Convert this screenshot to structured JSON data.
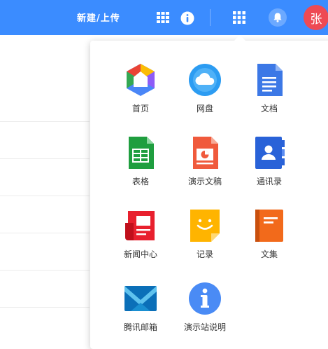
{
  "header": {
    "new_upload_label": "新建/上传",
    "avatar_text": "张",
    "colors": {
      "bar": "#3b8cff",
      "avatar": "#ee4a54"
    }
  },
  "apps_panel": {
    "items": [
      {
        "label": "首页",
        "icon": "home-icon"
      },
      {
        "label": "网盘",
        "icon": "cloud-drive-icon"
      },
      {
        "label": "文档",
        "icon": "document-icon"
      },
      {
        "label": "表格",
        "icon": "spreadsheet-icon"
      },
      {
        "label": "演示文稿",
        "icon": "presentation-icon"
      },
      {
        "label": "通讯录",
        "icon": "contacts-icon"
      },
      {
        "label": "新闻中心",
        "icon": "news-icon"
      },
      {
        "label": "记录",
        "icon": "notes-icon"
      },
      {
        "label": "文集",
        "icon": "collection-book-icon"
      },
      {
        "label": "腾讯邮箱",
        "icon": "mail-icon"
      },
      {
        "label": "演示站说明",
        "icon": "info-icon"
      }
    ]
  }
}
